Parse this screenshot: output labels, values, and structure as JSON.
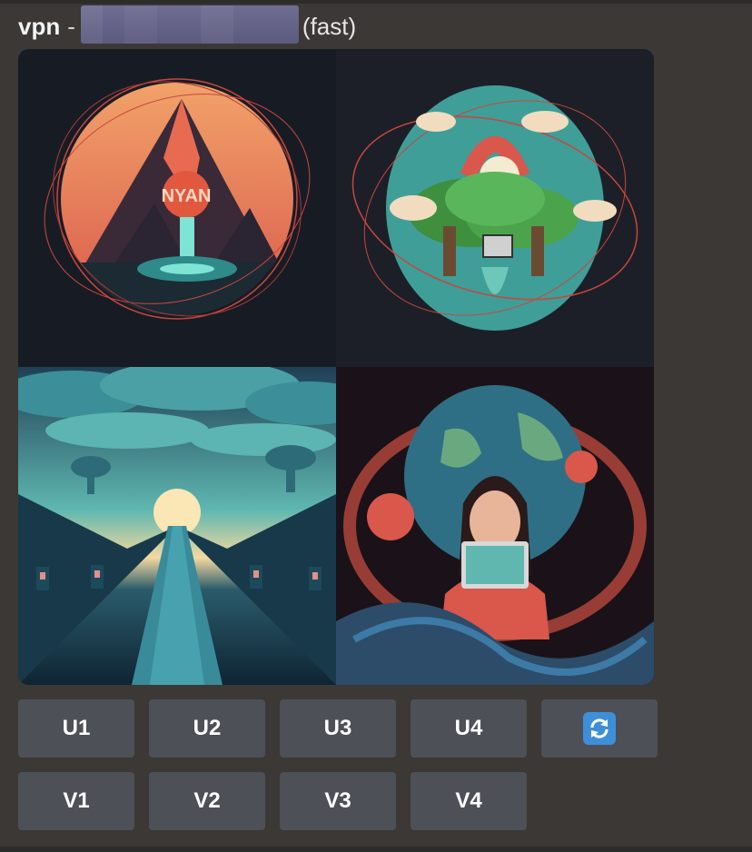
{
  "message": {
    "bot_name": "vpn",
    "separator": "-",
    "mode_suffix": "(fast)"
  },
  "image_grid": {
    "tiles": [
      {
        "caption_text": "NYAN"
      },
      {
        "caption_text": ""
      },
      {
        "caption_text": ""
      },
      {
        "caption_text": ""
      }
    ]
  },
  "buttons": {
    "upscale": [
      "U1",
      "U2",
      "U3",
      "U4"
    ],
    "variation": [
      "V1",
      "V2",
      "V3",
      "V4"
    ],
    "reroll_icon": "refresh-icon"
  },
  "colors": {
    "background": "#3b3835",
    "button": "#4e5058",
    "reroll_accent": "#3e8fd9"
  }
}
